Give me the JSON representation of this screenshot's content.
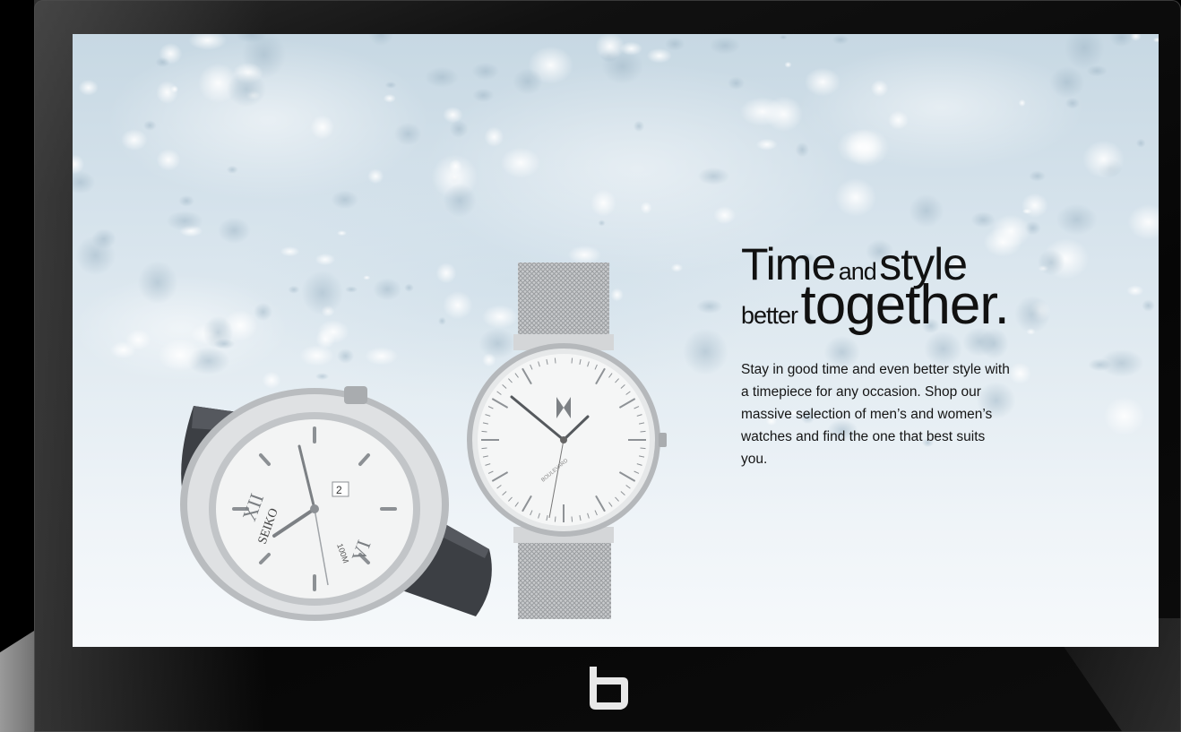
{
  "headline": {
    "w1": "Time",
    "w2": "and",
    "w3": "style",
    "w4": "better",
    "w5": "together."
  },
  "body": "Stay in good time and even better style with a timepiece for any occasion. Shop our massive selection of men’s and women’s watches and find the one that best suits you.",
  "watch_left": {
    "brand": "SEIKO",
    "depth": "100M",
    "date": "2"
  },
  "watch_right": {
    "model": "BOULEVARD"
  },
  "icons": {
    "brand_logo": "brand-logo-icon"
  },
  "colors": {
    "bezel": "#0a0a0a",
    "screen_top": "#c7d8e3",
    "screen_bottom": "#f6f9fb",
    "text": "#111111",
    "strap": "#3c3f44",
    "steel": "#c9cbcd"
  }
}
